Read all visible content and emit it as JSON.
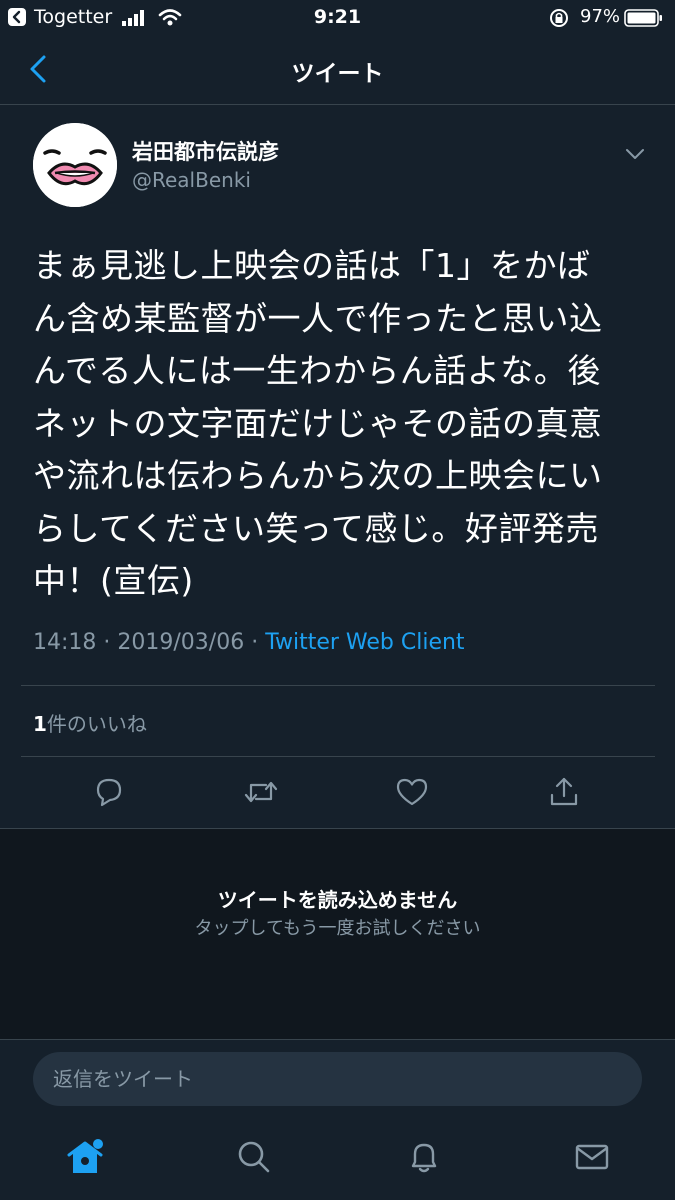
{
  "status_bar": {
    "back_app": "Togetter",
    "time": "9:21",
    "battery_pct": "97%"
  },
  "nav": {
    "title": "ツイート",
    "back_icon": "chevron-left-icon"
  },
  "tweet": {
    "display_name": "岩田都市伝説彦",
    "handle": "@RealBenki",
    "text": "まぁ見逃し上映会の話は「1」をかば\nん含め某監督が一人で作ったと思い込\nんでる人には一生わからん話よな。後\nネットの文字面だけじゃその話の真意\nや流れは伝わらんから次の上映会にい\nらしてください笑って感じ。好評発売\n中！(宣伝)",
    "time": "14:18",
    "date": "2019/03/06",
    "separator": " · ",
    "client": "Twitter Web Client",
    "likes_count": "1",
    "likes_label": "件のいいね"
  },
  "error": {
    "title": "ツイートを読み込めません",
    "subtitle": "タップしてもう一度お試しください"
  },
  "reply": {
    "placeholder": "返信をツイート"
  },
  "colors": {
    "background": "#15202b",
    "accent": "#1da1f2",
    "secondary_text": "#8899a6"
  }
}
